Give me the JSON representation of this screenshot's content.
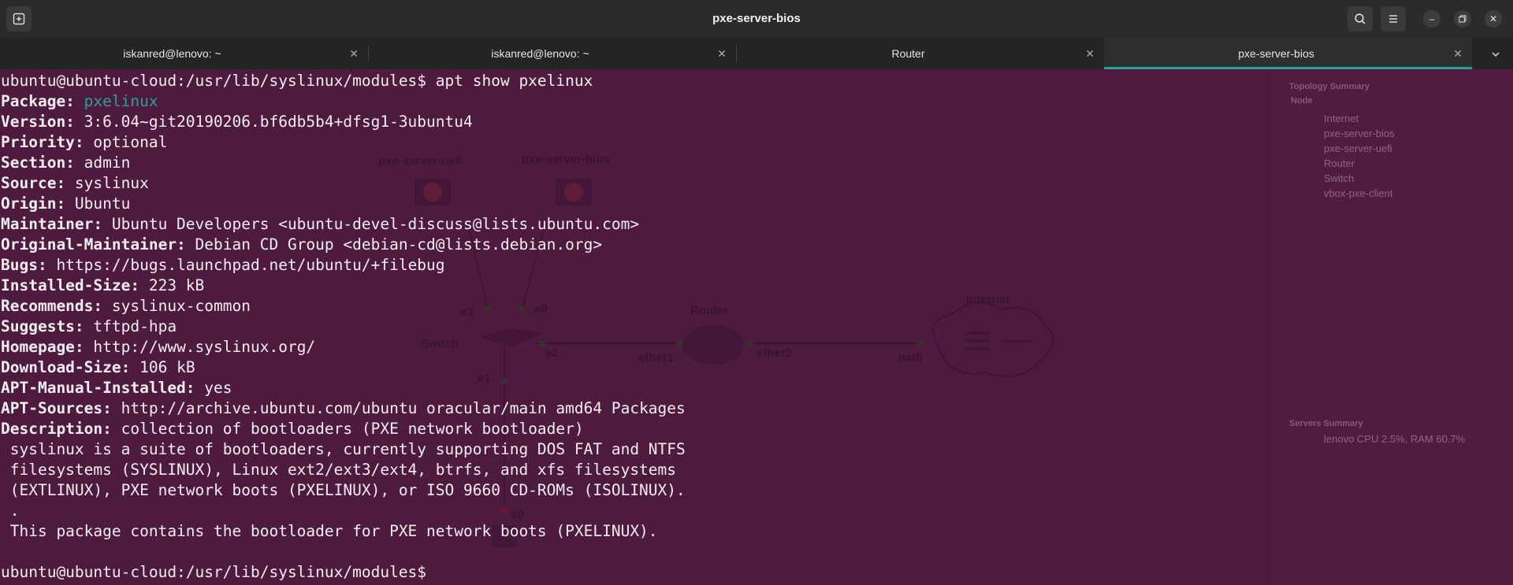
{
  "window": {
    "title": "pxe-server-bios",
    "new_tab_icon": "new-tab-icon",
    "search_icon": "search-icon",
    "menu_icon": "hamburger-menu-icon"
  },
  "tabs": [
    {
      "label": "iskanred@lenovo: ~",
      "active": false
    },
    {
      "label": "iskanred@lenovo: ~",
      "active": false
    },
    {
      "label": "Router",
      "active": false
    },
    {
      "label": "pxe-server-bios",
      "active": true
    }
  ],
  "terminal": {
    "prompt": "ubuntu@ubuntu-cloud:/usr/lib/syslinux/modules$",
    "command": " apt show pxelinux",
    "fields": [
      {
        "key": "Package:",
        "value": " pxelinux"
      },
      {
        "key": "Version:",
        "value": " 3:6.04~git20190206.bf6db5b4+dfsg1-3ubuntu4"
      },
      {
        "key": "Priority:",
        "value": " optional"
      },
      {
        "key": "Section:",
        "value": " admin"
      },
      {
        "key": "Source:",
        "value": " syslinux"
      },
      {
        "key": "Origin:",
        "value": " Ubuntu"
      },
      {
        "key": "Maintainer:",
        "value": " Ubuntu Developers <ubuntu-devel-discuss@lists.ubuntu.com>"
      },
      {
        "key": "Original-Maintainer:",
        "value": " Debian CD Group <debian-cd@lists.debian.org>"
      },
      {
        "key": "Bugs:",
        "value": " https://bugs.launchpad.net/ubuntu/+filebug"
      },
      {
        "key": "Installed-Size:",
        "value": " 223 kB"
      },
      {
        "key": "Recommends:",
        "value": " syslinux-common"
      },
      {
        "key": "Suggests:",
        "value": " tftpd-hpa"
      },
      {
        "key": "Homepage:",
        "value": " http://www.syslinux.org/"
      },
      {
        "key": "Download-Size:",
        "value": " 106 kB"
      },
      {
        "key": "APT-Manual-Installed:",
        "value": " yes"
      },
      {
        "key": "APT-Sources:",
        "value": " http://archive.ubuntu.com/ubuntu oracular/main amd64 Packages"
      },
      {
        "key": "Description:",
        "value": " collection of bootloaders (PXE network bootloader)"
      }
    ],
    "description_lines": [
      " syslinux is a suite of bootloaders, currently supporting DOS FAT and NTFS",
      " filesystems (SYSLINUX), Linux ext2/ext3/ext4, btrfs, and xfs filesystems",
      " (EXTLINUX), PXE network boots (PXELINUX), or ISO 9660 CD-ROMs (ISOLINUX).",
      " .",
      " This package contains the bootloader for PXE network boots (PXELINUX)."
    ],
    "final_prompt": "ubuntu@ubuntu-cloud:/usr/lib/syslinux/modules$"
  },
  "background": {
    "nodes": [
      "pxe-server-uefi",
      "pxe-server-bios",
      "Router",
      "Internet",
      "Switch"
    ],
    "ports": [
      "e3",
      "e0",
      "e2",
      "e1",
      "ether1",
      "ether2",
      "nat0",
      "e0"
    ],
    "topology_summary": {
      "title": "Topology Summary",
      "column": "Node",
      "items": [
        "Internet",
        "pxe-server-bios",
        "pxe-server-uefi",
        "Router",
        "Switch",
        "vbox-pxe-client"
      ]
    },
    "servers_summary": {
      "title": "Servers Summary",
      "items": [
        "lenovo CPU 2.5%, RAM 60.7%"
      ]
    }
  },
  "colors": {
    "terminal_bg": "#4e1b3e",
    "accent": "#2aa198",
    "text": "#f2eef0"
  }
}
